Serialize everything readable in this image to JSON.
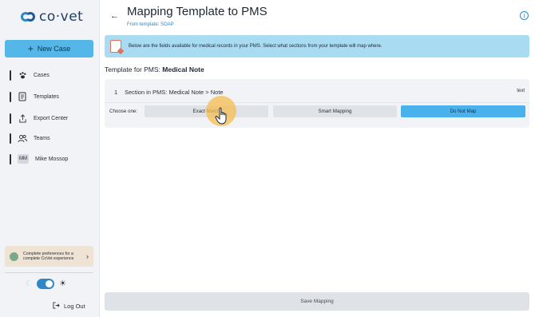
{
  "app": {
    "logo_text": "co·vet",
    "brand_color": "#2f87c8"
  },
  "sidebar": {
    "new_case_label": "New Case",
    "items": [
      {
        "label": "Cases",
        "icon": "paw-icon"
      },
      {
        "label": "Templates",
        "icon": "document-icon"
      },
      {
        "label": "Export Center",
        "icon": "export-icon"
      },
      {
        "label": "Teams",
        "icon": "team-icon"
      },
      {
        "label": "Mike Mossop",
        "icon": "avatar",
        "initials": "MM"
      }
    ],
    "prefs_text": "Complete preferences for a complete CoVet experience",
    "theme": "light",
    "logout_label": "Log Out"
  },
  "header": {
    "title": "Mapping Template to PMS",
    "subtitle": "From template: SOAP"
  },
  "banner": {
    "text": "Below are the fields available for medical records in your PMS. Select what sections from your template will map where."
  },
  "template": {
    "prefix": "Template for PMS: ",
    "name": "Medical Note"
  },
  "fields": [
    {
      "number": "1",
      "label": "Section in PMS: Medical Note > Note",
      "type": "text",
      "choose_label": "Choose one:",
      "options": [
        "Exact Match",
        "Smart Mapping",
        "Do Not Map"
      ],
      "selected": "Do Not Map"
    }
  ],
  "footer": {
    "save_label": "Save Mapping"
  }
}
